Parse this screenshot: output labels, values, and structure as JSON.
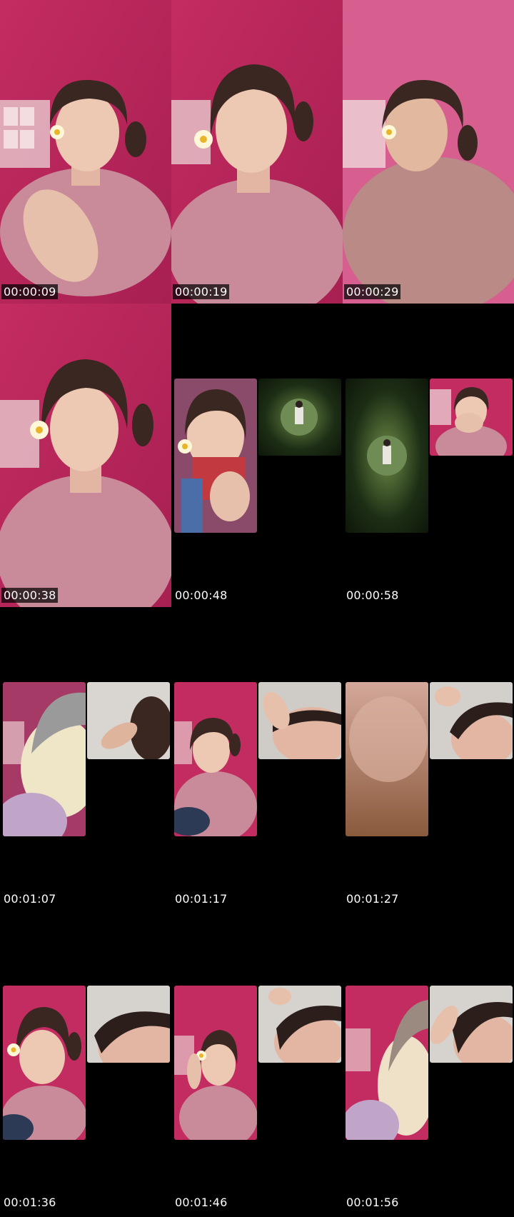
{
  "frames": [
    {
      "timestamp": "00:00:09"
    },
    {
      "timestamp": "00:00:19"
    },
    {
      "timestamp": "00:00:29"
    },
    {
      "timestamp": "00:00:38"
    },
    {
      "timestamp": "00:00:48"
    },
    {
      "timestamp": "00:00:58"
    },
    {
      "timestamp": "00:01:07"
    },
    {
      "timestamp": "00:01:17"
    },
    {
      "timestamp": "00:01:27"
    },
    {
      "timestamp": "00:01:36"
    },
    {
      "timestamp": "00:01:46"
    },
    {
      "timestamp": "00:01:56"
    }
  ],
  "colors": {
    "wall_pink": "#c2285e",
    "shirt_pink": "#c98a9a",
    "skin": "#e8c2ad",
    "hair": "#3a2722",
    "flower": "#fff7d8",
    "background": "#000000"
  }
}
